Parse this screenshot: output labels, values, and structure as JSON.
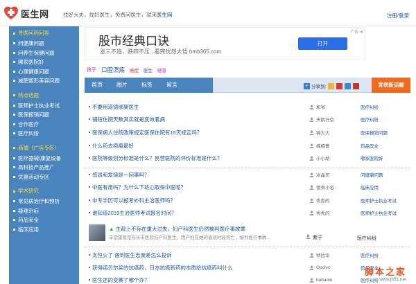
{
  "header": {
    "logo_text": "医生网",
    "slogan_prefix": "找好大夫，找好医生，免费问医生，就来",
    "slogan_brand": "医生网",
    "login": "注册/登录"
  },
  "sidebar": {
    "sections": [
      {
        "head": "寻医问药问答",
        "items": [
          "问健康问题",
          "问养生保健问题",
          "哪家医院好",
          "心理健康问题",
          "减肥整形美容问题"
        ]
      },
      {
        "head": "热点话题",
        "items": [
          "医师护士执业考试",
          "医保报销问题",
          "合作医疗",
          "医疗纠纷"
        ]
      },
      {
        "head": "商城（广告专区）",
        "items": [
          "医疗器械/康复设备",
          "高科技产品推广",
          "优惠活动专区"
        ]
      },
      {
        "head": "学术研究",
        "items": [
          "常见病治疗和预防",
          "疑难杂症",
          "药品安全",
          "临床应用"
        ]
      }
    ]
  },
  "ad": {
    "title": "股市经典口诀",
    "sub": "涨三不追，跌四不压...看完忧然大悟 hmb365.com",
    "button": "打开",
    "mark": "广告"
  },
  "tags": {
    "items": [
      {
        "text": "孩子",
        "color": "#c81dc8",
        "size": 7
      },
      {
        "text": "口腔溃疡",
        "color": "#1a55a8",
        "size": 8.5
      },
      {
        "text": "癌症",
        "color": "#d8261c",
        "size": 6.5
      },
      {
        "text": "医生",
        "color": "#1a55a8",
        "size": 6.5
      },
      {
        "text": "感冒",
        "color": "#c81dc8",
        "size": 6.5
      }
    ]
  },
  "nav": {
    "tabs": [
      "首页",
      "图片",
      "标签",
      "留言"
    ],
    "share_label": "分享到:",
    "new_question": "发表新话题"
  },
  "list": {
    "group1": [
      {
        "title": "不要用道德绑架医生",
        "user": "和爷",
        "cat": "医疗纠纷"
      },
      {
        "title": "铺短住院天数其实就是变效着病",
        "user": "天鹅行空",
        "cat": "医疗纠纷"
      },
      {
        "title": "医保病人住院政策规定医保住院有15天规定吗？",
        "user": "钟大大",
        "cat": "医保报销问题"
      },
      {
        "title": "什么药去疤痕最好",
        "user": "楠楠曹",
        "cat": "药品安全"
      },
      {
        "title": "医院等级划分标准是什么？民营医院的评价标准是什么？",
        "user": "小小胡",
        "cat": "哪家医院好"
      }
    ],
    "group2": [
      {
        "title": "感冒和发烧是一回事吗？",
        "user": "冰晶灵",
        "cat": "问健康问题"
      },
      {
        "title": "中医有用吗？为什么下班心取得中医呢？",
        "user": "德骨小名",
        "cat": "临床应用"
      },
      {
        "title": "中专学历可以报考外科主治医师吗？",
        "user": "秀秀的",
        "cat": "医师护士执业考试"
      },
      {
        "title": "谁知道2019主治医师考试报名时间？",
        "user": "秀秀的",
        "cat": "医师护士执业考试"
      }
    ],
    "pic_item": {
      "title": "主观上不存在重大过失，妇产科医生仍然被判医疗事故罪",
      "desc": "辛堂雷管是东乐市医院妇产科医生，因产妇在她的值班时段死亡，被判医疗事故...",
      "user": "紫子",
      "cat": "医疗纠纷"
    },
    "group3": [
      {
        "title": "太恒火了 遇到医生志度差怎么投诉",
        "user": "特拉华",
        "cat": "医疗纠纷"
      },
      {
        "title": "获得诺贝尔奖的抗癌药，日本抗癌新药的本质给抗癌药叫什么",
        "user": "Opdivo",
        "cat": "药品安全"
      },
      {
        "title": "医生还的变赛了哪个办？",
        "user": "babaolu",
        "cat": "医疗纠纷"
      }
    ]
  },
  "watermark": {
    "cn": "脚本之家",
    "url": "www.jb51.net"
  },
  "colors": {
    "sidebar_bg": "#4a84bd",
    "sidebar_head": "#ffd94a",
    "link": "#1a55a8",
    "new_question_bg": "#f16a1e",
    "ad_button": "#2b6de4"
  }
}
